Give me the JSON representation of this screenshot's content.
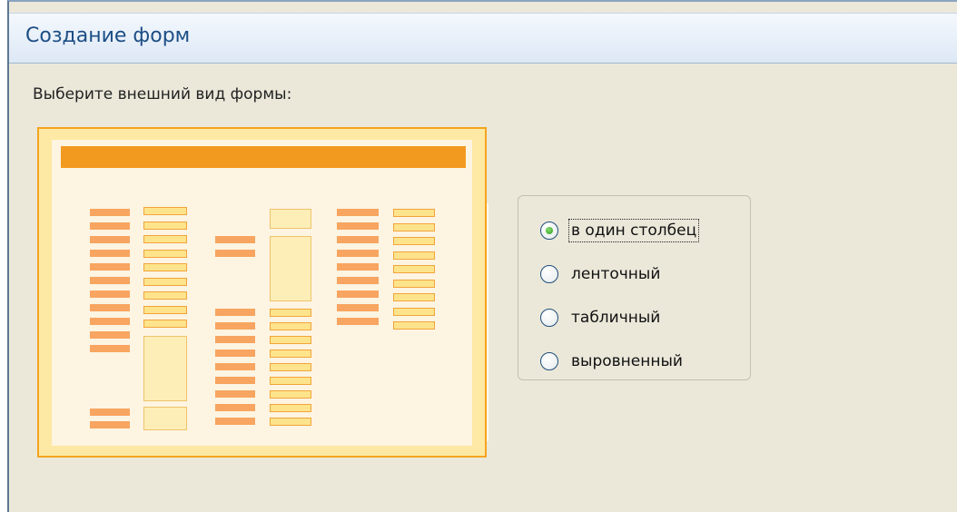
{
  "window": {
    "title": "Создание форм"
  },
  "prompt": "Выберите внешний вид формы:",
  "preview": {
    "description_label": ""
  },
  "layout_options": [
    {
      "label": "в один столбец",
      "selected": true
    },
    {
      "label": "ленточный",
      "selected": false
    },
    {
      "label": "табличный",
      "selected": false
    },
    {
      "label": "выровненный",
      "selected": false
    }
  ],
  "colors": {
    "accent_orange": "#f29a20",
    "window_bg": "#ebe8da",
    "title_text": "#1c4e85",
    "radio_selected": "#2c9a21"
  }
}
